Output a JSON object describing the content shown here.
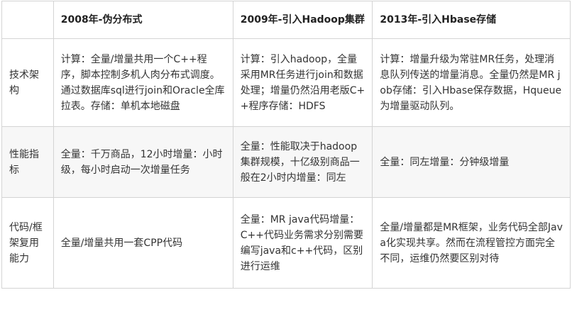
{
  "table": {
    "headers": [
      "",
      "2008年-伪分布式",
      "2009年-引入Hadoop集群",
      "2013年-引入Hbase存储"
    ],
    "rows": [
      {
        "label": "技术架构",
        "cells": [
          "计算：全量/增量共用一个C++程序，脚本控制多机人肉分布式调度。通过数据库sql进行join和Oracle全库拉表。存储：单机本地磁盘",
          "计算：引入hadoop，全量采用MR任务进行join和数据处理；增量仍然沿用老版C++程序存储：HDFS",
          "计算：增量升级为常驻MR任务，处理消息队列传送的增量消息。全量仍然是MR job存储：引入Hbase保存数据，Hqueue为增量驱动队列。"
        ]
      },
      {
        "label": "性能指标",
        "cells": [
          "全量：千万商品，12小时增量：小时级，每小时启动一次增量任务",
          "全量：性能取决于hadoop集群规模，十亿级别商品一般在2小时内增量：同左",
          "全量：同左增量：分钟级增量"
        ]
      },
      {
        "label": "代码/框架复用能力",
        "cells": [
          "全量/增量共用一套CPP代码",
          "全量：MR java代码增量：C++代码业务需求分别需要编写java和c++代码，区别进行运维",
          "全量/增量都是MR框架，业务代码全部Java化实现共享。然而在流程管控方面完全不同，运维仍然要区别对待"
        ]
      }
    ]
  }
}
